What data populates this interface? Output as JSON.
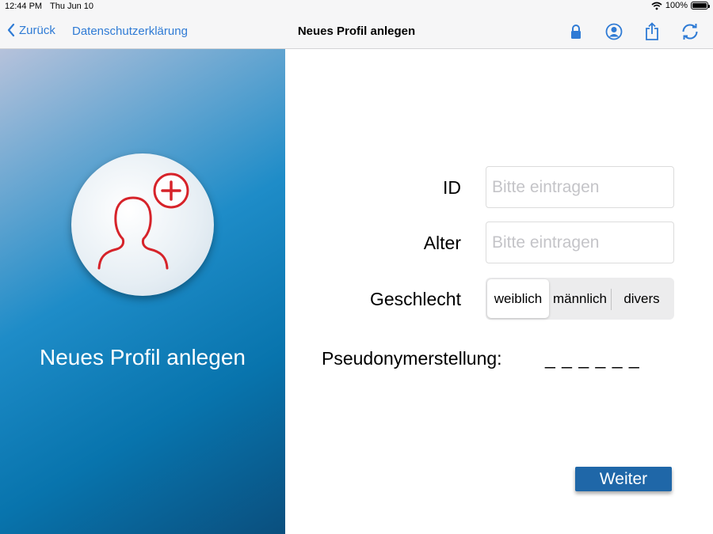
{
  "status_bar": {
    "time": "12:44 PM",
    "date": "Thu Jun 10",
    "battery": "100%",
    "battery_level": 1.0
  },
  "nav": {
    "back_label": "Zurück",
    "privacy_label": "Datenschutzerklärung",
    "title": "Neues Profil anlegen",
    "icons": [
      "lock-icon",
      "profile-icon",
      "share-icon",
      "refresh-icon"
    ],
    "accent_color": "#2f7bd5"
  },
  "left_panel": {
    "title": "Neues Profil anlegen",
    "icon": "add-person-icon",
    "icon_color": "#d6232a"
  },
  "form": {
    "id_label": "ID",
    "id_placeholder": "Bitte eintragen",
    "id_value": "",
    "age_label": "Alter",
    "age_placeholder": "Bitte eintragen",
    "age_value": "",
    "gender_label": "Geschlecht",
    "gender_options": [
      "weiblich",
      "männlich",
      "divers"
    ],
    "gender_selected": "weiblich",
    "pseudonym_label": "Pseudonymerstellung:",
    "pseudonym_value": "_ _ _ _ _ _"
  },
  "weiter_label": "Weiter",
  "button_color": "#1f67a8"
}
